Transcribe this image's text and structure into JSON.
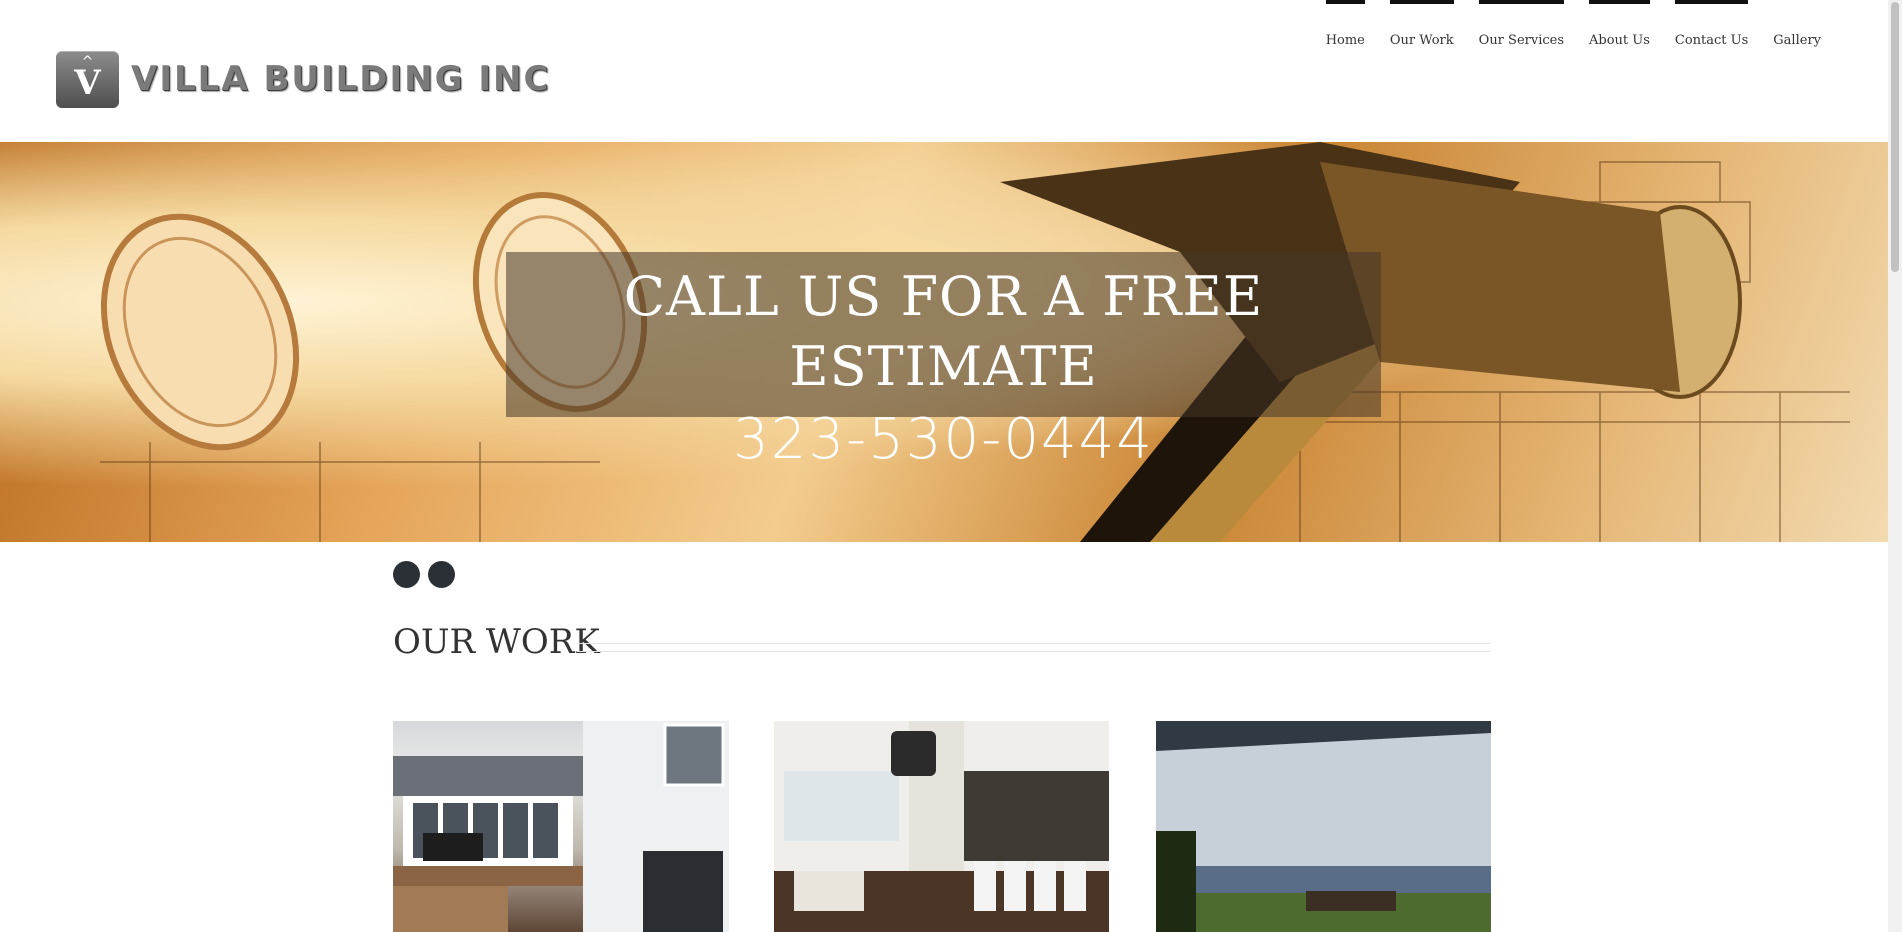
{
  "logo": {
    "mark": "V",
    "mark_icon": "caret-up-icon",
    "name": "VILLA BUILDING INC"
  },
  "nav": {
    "items": [
      {
        "label": "Home"
      },
      {
        "label": "Our Work"
      },
      {
        "label": "Our Services"
      },
      {
        "label": "About Us"
      },
      {
        "label": "Contact Us"
      },
      {
        "label": "Gallery"
      }
    ]
  },
  "hero": {
    "line1": "CALL US FOR A FREE ESTIMATE",
    "line2": "323-530-0444"
  },
  "section": {
    "title": "OUR WORK"
  },
  "colors": {
    "dot": "#2b2f36",
    "nav_bar": "#111111",
    "heading": "#333333"
  }
}
